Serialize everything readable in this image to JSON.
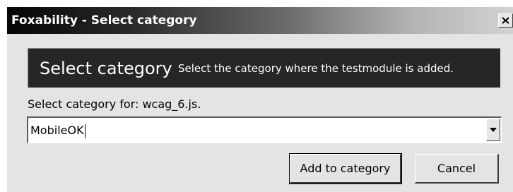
{
  "window": {
    "title": "Foxability - Select category",
    "close_icon": "close-icon"
  },
  "banner": {
    "title": "Select category",
    "description": "Select the category where the testmodule is added."
  },
  "form": {
    "label": "Select category for: wcag_6.js.",
    "category_value": "MobileOK",
    "dropdown_icon": "chevron-down-icon"
  },
  "buttons": {
    "add_label": "Add to category",
    "cancel_label": "Cancel"
  },
  "colors": {
    "banner_background": "#262626",
    "dialog_background": "#e4e4e4"
  }
}
